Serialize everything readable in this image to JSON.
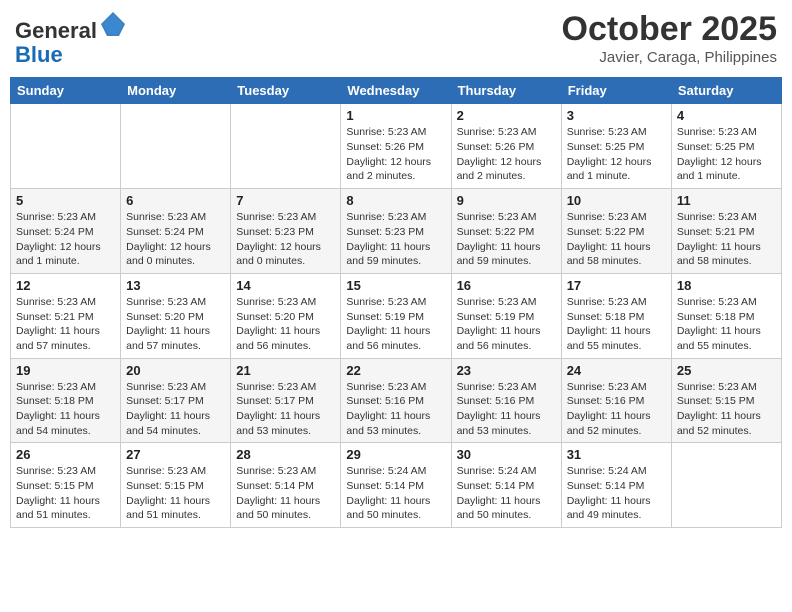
{
  "header": {
    "logo_general": "General",
    "logo_blue": "Blue",
    "month_year": "October 2025",
    "location": "Javier, Caraga, Philippines"
  },
  "weekdays": [
    "Sunday",
    "Monday",
    "Tuesday",
    "Wednesday",
    "Thursday",
    "Friday",
    "Saturday"
  ],
  "weeks": [
    [
      {
        "day": "",
        "info": ""
      },
      {
        "day": "",
        "info": ""
      },
      {
        "day": "",
        "info": ""
      },
      {
        "day": "1",
        "info": "Sunrise: 5:23 AM\nSunset: 5:26 PM\nDaylight: 12 hours\nand 2 minutes."
      },
      {
        "day": "2",
        "info": "Sunrise: 5:23 AM\nSunset: 5:26 PM\nDaylight: 12 hours\nand 2 minutes."
      },
      {
        "day": "3",
        "info": "Sunrise: 5:23 AM\nSunset: 5:25 PM\nDaylight: 12 hours\nand 1 minute."
      },
      {
        "day": "4",
        "info": "Sunrise: 5:23 AM\nSunset: 5:25 PM\nDaylight: 12 hours\nand 1 minute."
      }
    ],
    [
      {
        "day": "5",
        "info": "Sunrise: 5:23 AM\nSunset: 5:24 PM\nDaylight: 12 hours\nand 1 minute."
      },
      {
        "day": "6",
        "info": "Sunrise: 5:23 AM\nSunset: 5:24 PM\nDaylight: 12 hours\nand 0 minutes."
      },
      {
        "day": "7",
        "info": "Sunrise: 5:23 AM\nSunset: 5:23 PM\nDaylight: 12 hours\nand 0 minutes."
      },
      {
        "day": "8",
        "info": "Sunrise: 5:23 AM\nSunset: 5:23 PM\nDaylight: 11 hours\nand 59 minutes."
      },
      {
        "day": "9",
        "info": "Sunrise: 5:23 AM\nSunset: 5:22 PM\nDaylight: 11 hours\nand 59 minutes."
      },
      {
        "day": "10",
        "info": "Sunrise: 5:23 AM\nSunset: 5:22 PM\nDaylight: 11 hours\nand 58 minutes."
      },
      {
        "day": "11",
        "info": "Sunrise: 5:23 AM\nSunset: 5:21 PM\nDaylight: 11 hours\nand 58 minutes."
      }
    ],
    [
      {
        "day": "12",
        "info": "Sunrise: 5:23 AM\nSunset: 5:21 PM\nDaylight: 11 hours\nand 57 minutes."
      },
      {
        "day": "13",
        "info": "Sunrise: 5:23 AM\nSunset: 5:20 PM\nDaylight: 11 hours\nand 57 minutes."
      },
      {
        "day": "14",
        "info": "Sunrise: 5:23 AM\nSunset: 5:20 PM\nDaylight: 11 hours\nand 56 minutes."
      },
      {
        "day": "15",
        "info": "Sunrise: 5:23 AM\nSunset: 5:19 PM\nDaylight: 11 hours\nand 56 minutes."
      },
      {
        "day": "16",
        "info": "Sunrise: 5:23 AM\nSunset: 5:19 PM\nDaylight: 11 hours\nand 56 minutes."
      },
      {
        "day": "17",
        "info": "Sunrise: 5:23 AM\nSunset: 5:18 PM\nDaylight: 11 hours\nand 55 minutes."
      },
      {
        "day": "18",
        "info": "Sunrise: 5:23 AM\nSunset: 5:18 PM\nDaylight: 11 hours\nand 55 minutes."
      }
    ],
    [
      {
        "day": "19",
        "info": "Sunrise: 5:23 AM\nSunset: 5:18 PM\nDaylight: 11 hours\nand 54 minutes."
      },
      {
        "day": "20",
        "info": "Sunrise: 5:23 AM\nSunset: 5:17 PM\nDaylight: 11 hours\nand 54 minutes."
      },
      {
        "day": "21",
        "info": "Sunrise: 5:23 AM\nSunset: 5:17 PM\nDaylight: 11 hours\nand 53 minutes."
      },
      {
        "day": "22",
        "info": "Sunrise: 5:23 AM\nSunset: 5:16 PM\nDaylight: 11 hours\nand 53 minutes."
      },
      {
        "day": "23",
        "info": "Sunrise: 5:23 AM\nSunset: 5:16 PM\nDaylight: 11 hours\nand 53 minutes."
      },
      {
        "day": "24",
        "info": "Sunrise: 5:23 AM\nSunset: 5:16 PM\nDaylight: 11 hours\nand 52 minutes."
      },
      {
        "day": "25",
        "info": "Sunrise: 5:23 AM\nSunset: 5:15 PM\nDaylight: 11 hours\nand 52 minutes."
      }
    ],
    [
      {
        "day": "26",
        "info": "Sunrise: 5:23 AM\nSunset: 5:15 PM\nDaylight: 11 hours\nand 51 minutes."
      },
      {
        "day": "27",
        "info": "Sunrise: 5:23 AM\nSunset: 5:15 PM\nDaylight: 11 hours\nand 51 minutes."
      },
      {
        "day": "28",
        "info": "Sunrise: 5:23 AM\nSunset: 5:14 PM\nDaylight: 11 hours\nand 50 minutes."
      },
      {
        "day": "29",
        "info": "Sunrise: 5:24 AM\nSunset: 5:14 PM\nDaylight: 11 hours\nand 50 minutes."
      },
      {
        "day": "30",
        "info": "Sunrise: 5:24 AM\nSunset: 5:14 PM\nDaylight: 11 hours\nand 50 minutes."
      },
      {
        "day": "31",
        "info": "Sunrise: 5:24 AM\nSunset: 5:14 PM\nDaylight: 11 hours\nand 49 minutes."
      },
      {
        "day": "",
        "info": ""
      }
    ]
  ]
}
